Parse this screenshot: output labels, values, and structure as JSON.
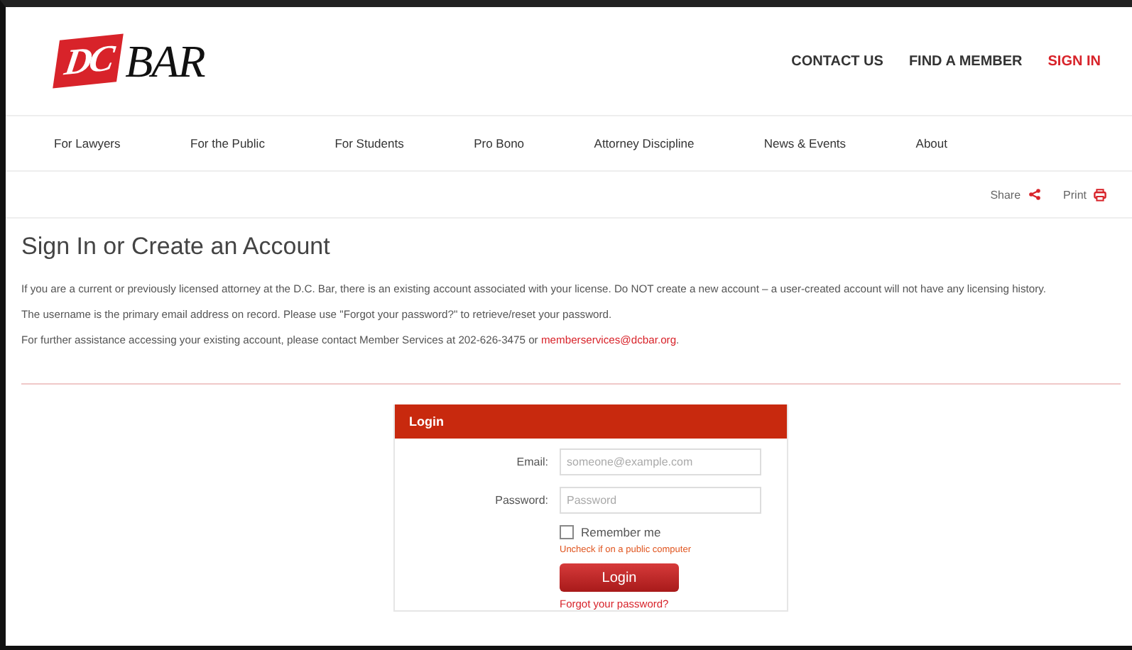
{
  "logo": {
    "mark": "DC",
    "word": "BAR"
  },
  "top_links": [
    {
      "label": "CONTACT US",
      "selected": false
    },
    {
      "label": "FIND A MEMBER",
      "selected": false
    },
    {
      "label": "SIGN IN",
      "selected": true
    }
  ],
  "nav": [
    "For Lawyers",
    "For the Public",
    "For Students",
    "Pro Bono",
    "Attorney Discipline",
    "News & Events",
    "About"
  ],
  "tools": [
    {
      "label": "Share",
      "kind": "share"
    },
    {
      "label": "Print",
      "kind": "print"
    }
  ],
  "title": "Sign In or Create an Account",
  "paragraphs": [
    {
      "text": "If you are a current or previously licensed attorney at the D.C. Bar, there is an existing account associated with your license. Do NOT create a new account – a user-created account will not have any licensing history."
    },
    {
      "text": "The username is the primary email address on record. Please use \"Forgot your password?\" to retrieve/reset your password."
    },
    {
      "text": "For further assistance accessing your existing account, please contact Member Services at 202-626-3475 or",
      "link": "memberservices@dcbar.org",
      "tail": "."
    }
  ],
  "login": {
    "header": "Login",
    "fields": [
      {
        "label": "Email:",
        "placeholder": "someone@example.com"
      },
      {
        "label": "Password:",
        "placeholder": "Password"
      }
    ],
    "remember": {
      "label": "Remember me",
      "checked": false
    },
    "hint": "Uncheck if on a public computer",
    "button": "Login",
    "forgot": "Forgot your password?"
  }
}
